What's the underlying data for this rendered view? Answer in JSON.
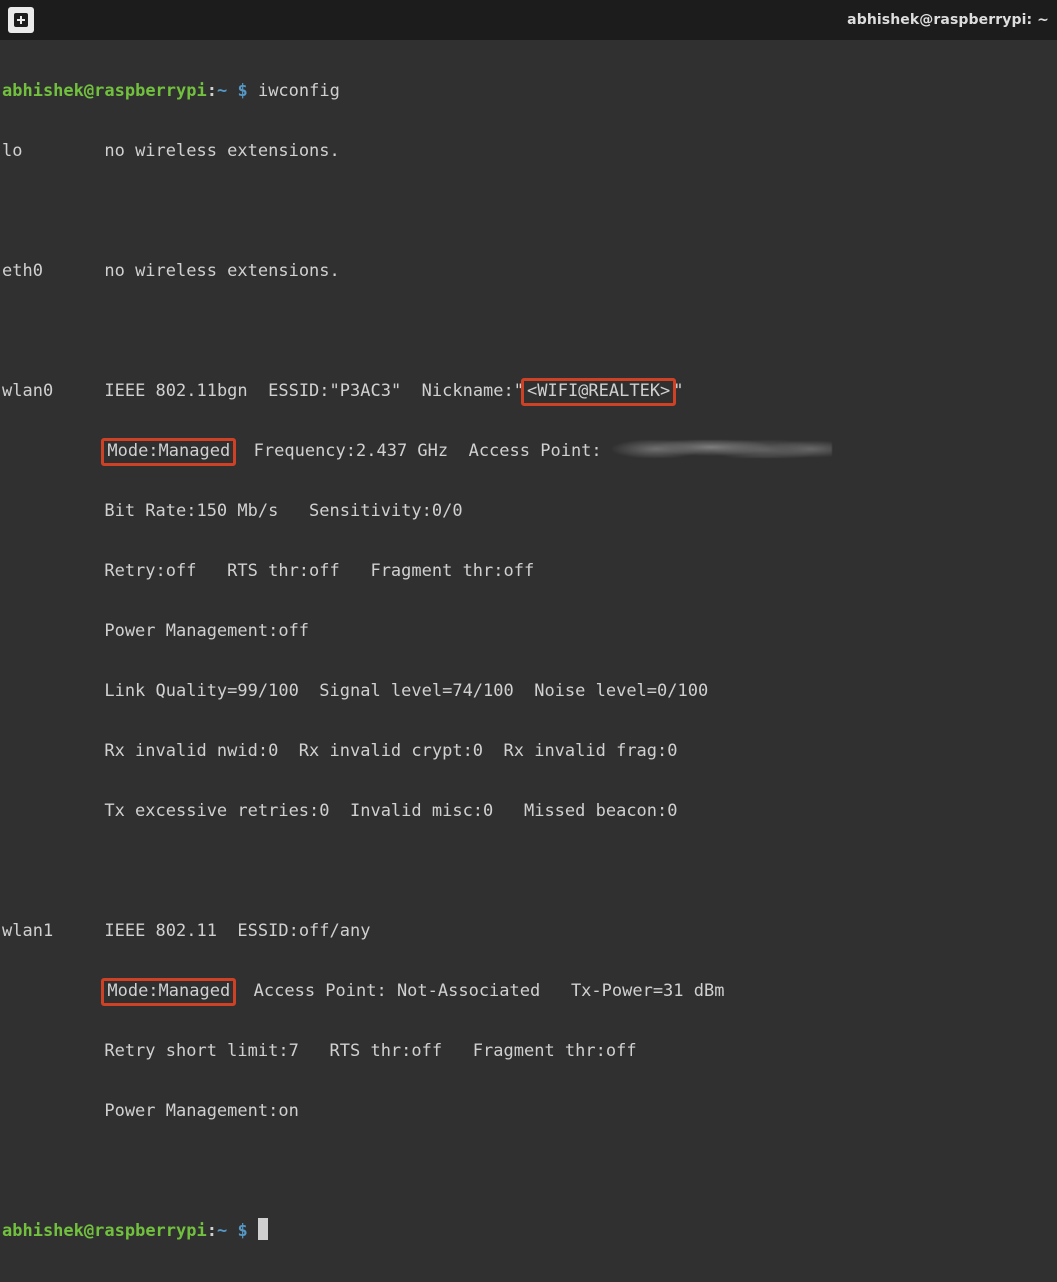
{
  "titlebar": {
    "title": "abhishek@raspberrypi: ~"
  },
  "prompt": {
    "user": "abhishek",
    "at": "@",
    "host": "raspberrypi",
    "colon": ":",
    "path": "~",
    "dollar": " $ "
  },
  "cmd1": "iwconfig",
  "lo_iface": "lo",
  "lo_rest": "        no wireless extensions.",
  "eth_iface": "eth0",
  "eth_rest": "      no wireless extensions.",
  "w0_iface": "wlan0",
  "w0_l1_rest": "     IEEE 802.11bgn  ESSID:\"P3AC3\"  Nickname:\"",
  "w0_nick_hl": "<WIFI@REALTEK>",
  "w0_l1_tail": "\"",
  "pad10": "          ",
  "w0_mode_hl": "Mode:Managed",
  "w0_l2_rest": "  Frequency:2.437 GHz  Access Point: ",
  "w0_l3": "          Bit Rate:150 Mb/s   Sensitivity:0/0",
  "w0_l4": "          Retry:off   RTS thr:off   Fragment thr:off",
  "w0_l5": "          Power Management:off",
  "w0_l6": "          Link Quality=99/100  Signal level=74/100  Noise level=0/100",
  "w0_l7": "          Rx invalid nwid:0  Rx invalid crypt:0  Rx invalid frag:0",
  "w0_l8": "          Tx excessive retries:0  Invalid misc:0   Missed beacon:0",
  "w1_iface": "wlan1",
  "w1_l1_rest": "     IEEE 802.11  ESSID:off/any",
  "w1_mode_hl": "Mode:Managed",
  "w1_l2_rest": "  Access Point: Not-Associated   Tx-Power=31 dBm",
  "w1_l3": "          Retry short limit:7   RTS thr:off   Fragment thr:off",
  "w1_l4": "          Power Management:on"
}
